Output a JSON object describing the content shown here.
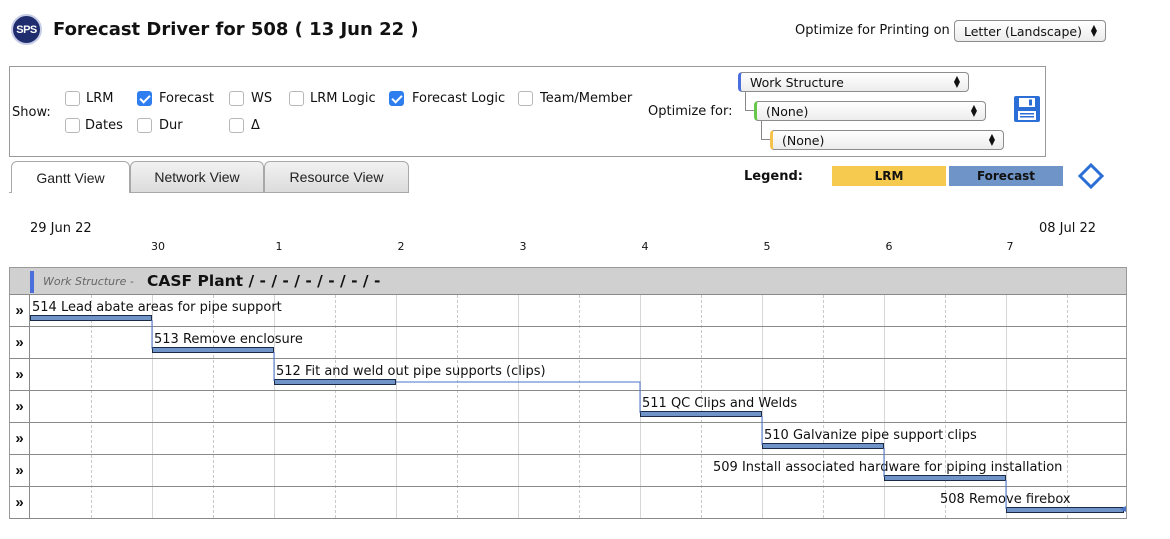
{
  "header": {
    "logo_text": "SPS",
    "title": "Forecast Driver for 508 ( 13 Jun 22 )",
    "print_label": "Optimize for Printing on",
    "print_value": "Letter (Landscape)"
  },
  "options": {
    "show_label": "Show:",
    "checkboxes": [
      {
        "label": "LRM",
        "checked": false
      },
      {
        "label": "Forecast",
        "checked": true
      },
      {
        "label": "WS",
        "checked": false
      },
      {
        "label": "LRM Logic",
        "checked": false
      },
      {
        "label": "Forecast Logic",
        "checked": true
      },
      {
        "label": "Team/Member",
        "checked": false
      },
      {
        "label": "Dates",
        "checked": false
      },
      {
        "label": "Dur",
        "checked": false
      },
      {
        "label": "Δ",
        "checked": false
      }
    ],
    "optimize_label": "Optimize for:",
    "select_1": "Work Structure",
    "select_2": "(None)",
    "select_3": "(None)",
    "save_icon": "floppy-disk-icon"
  },
  "tabs": [
    {
      "label": "Gantt View",
      "active": true
    },
    {
      "label": "Network View",
      "active": false
    },
    {
      "label": "Resource View",
      "active": false
    }
  ],
  "legend": {
    "label": "Legend:",
    "lrm": "LRM",
    "forecast": "Forecast",
    "lrm_color": "#f6c94f",
    "forecast_color": "#6f95c8",
    "diamond_icon": "milestone-diamond-icon"
  },
  "timeline": {
    "start_date": "29 Jun 22",
    "end_date": "08 Jul 22",
    "days": [
      "30",
      "1",
      "2",
      "3",
      "4",
      "5",
      "6",
      "7"
    ]
  },
  "gantt": {
    "group_prefix": "Work Structure -",
    "group_name": "CASF Plant / - / - / - / - / - / -",
    "expand_symbol": "»",
    "tasks": [
      {
        "label": "514 Lead abate areas for pipe support"
      },
      {
        "label": "513 Remove enclosure"
      },
      {
        "label": "512 Fit and weld out pipe supports (clips)"
      },
      {
        "label": "511 QC Clips and Welds"
      },
      {
        "label": "510 Galvanize pipe support clips"
      },
      {
        "label": "509 Install associated hardware for piping installation"
      },
      {
        "label": "508 Remove firebox"
      }
    ]
  }
}
